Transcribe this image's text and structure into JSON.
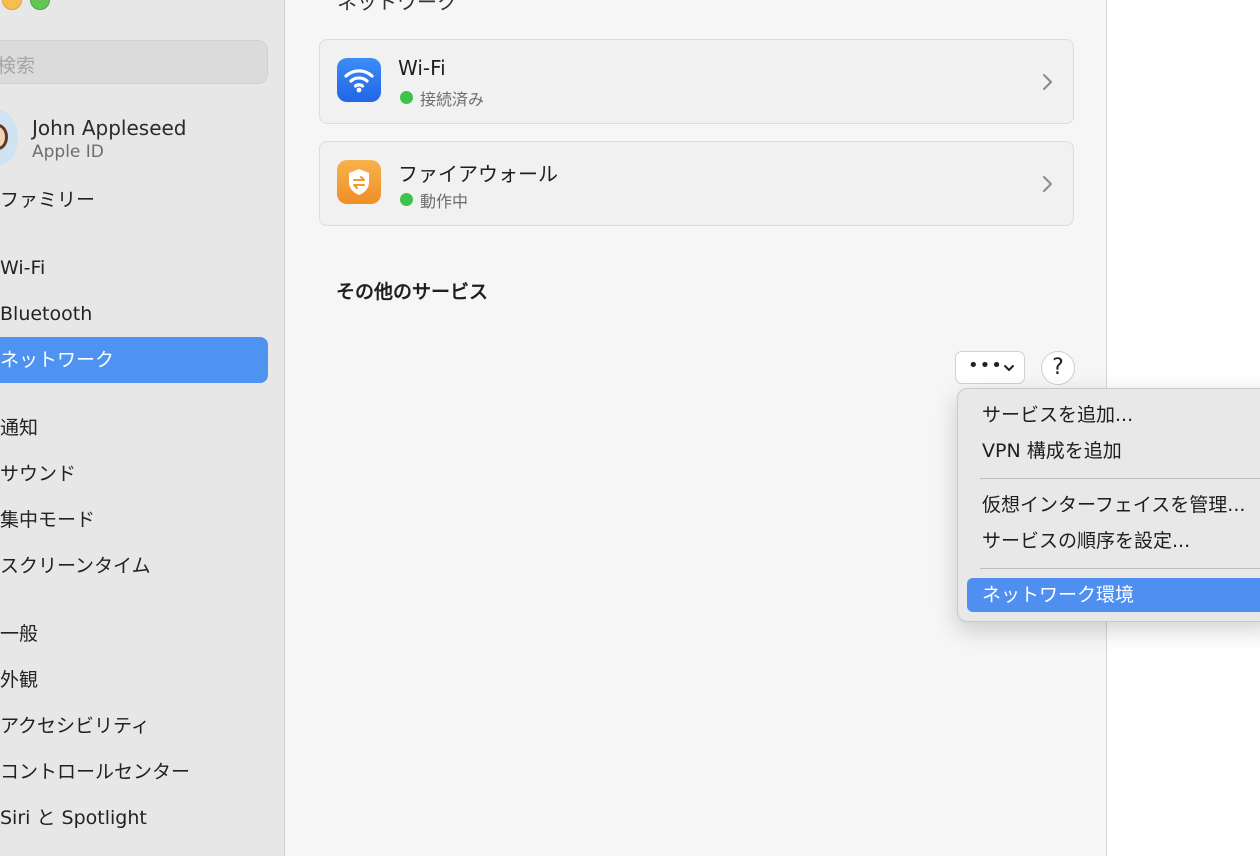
{
  "sidebar": {
    "search_placeholder": "検索",
    "user": {
      "name": "John Appleseed",
      "subtitle": "Apple ID"
    },
    "items": [
      {
        "label": "ファミリー"
      },
      {
        "label": "Wi-Fi"
      },
      {
        "label": "Bluetooth"
      },
      {
        "label": "ネットワーク",
        "selected": true
      },
      {
        "label": "通知"
      },
      {
        "label": "サウンド"
      },
      {
        "label": "集中モード"
      },
      {
        "label": "スクリーンタイム"
      },
      {
        "label": "一般"
      },
      {
        "label": "外観"
      },
      {
        "label": "アクセシビリティ"
      },
      {
        "label": "コントロールセンター"
      },
      {
        "label": "Siri と Spotlight"
      }
    ]
  },
  "content": {
    "title_cut": "ネットワーク",
    "cards": [
      {
        "title": "Wi-Fi",
        "status": "接続済み",
        "icon": "wifi-icon"
      },
      {
        "title": "ファイアウォール",
        "status": "動作中",
        "icon": "firewall-icon"
      }
    ],
    "section_title": "その他のサービス",
    "more_button": "•••",
    "help_button": "?"
  },
  "menu": {
    "items": [
      {
        "label": "サービスを追加..."
      },
      {
        "label": "VPN 構成を追加"
      },
      {
        "label": "仮想インターフェイスを管理..."
      },
      {
        "label": "サービスの順序を設定..."
      },
      {
        "label": "ネットワーク環境",
        "highlighted": true
      }
    ]
  },
  "colors": {
    "accent": "#4f93f2",
    "status_green": "#3fc24c"
  }
}
